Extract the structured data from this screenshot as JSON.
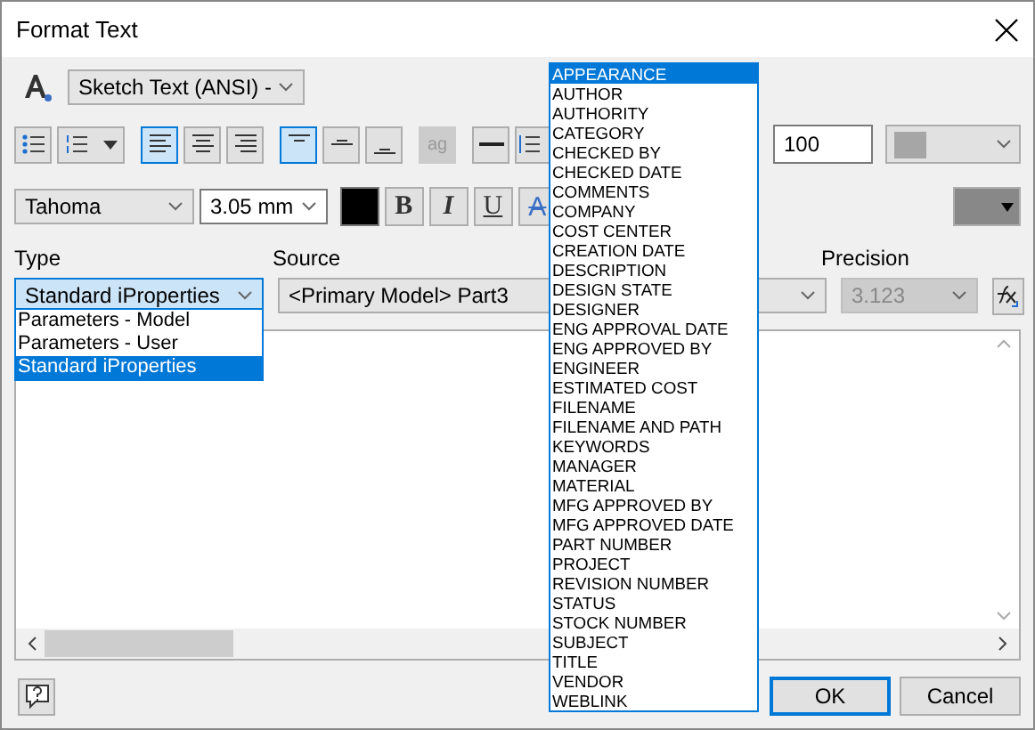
{
  "window": {
    "title": "Format Text"
  },
  "text_style": {
    "value": "Sketch Text (ANSI) -"
  },
  "toolbar": [
    {
      "kind": "bullets",
      "selected": false
    },
    {
      "kind": "numbering",
      "selected": false
    },
    {
      "kind": "align-left",
      "selected": true
    },
    {
      "kind": "align-center",
      "selected": false
    },
    {
      "kind": "align-right",
      "selected": false
    },
    {
      "kind": "valign-top",
      "selected": true
    },
    {
      "kind": "valign-middle",
      "selected": false
    },
    {
      "kind": "valign-bottom",
      "selected": false
    },
    {
      "kind": "stack",
      "disabled": true,
      "label": "ag"
    },
    {
      "kind": "line",
      "selected": false
    },
    {
      "kind": "line-spacing",
      "selected": false
    }
  ],
  "width_scale": {
    "value": "100"
  },
  "font": {
    "value": "Tahoma"
  },
  "size": {
    "value": "3.05 mm"
  },
  "format_buttons": [
    {
      "kind": "bold",
      "label": "B"
    },
    {
      "kind": "italic",
      "label": "I"
    },
    {
      "kind": "underline",
      "label": "U"
    },
    {
      "kind": "strike",
      "label": "A"
    }
  ],
  "type": {
    "label": "Type",
    "value": "Standard iProperties",
    "options": [
      {
        "label": "Parameters - Model",
        "selected": false
      },
      {
        "label": "Parameters - User",
        "selected": false
      },
      {
        "label": "Standard iProperties",
        "selected": true
      }
    ]
  },
  "source": {
    "label": "Source",
    "value": "<Primary Model> Part3",
    "options": [
      {
        "label": "APPEARANCE",
        "selected": true
      },
      {
        "label": "AUTHOR",
        "selected": false
      },
      {
        "label": "AUTHORITY",
        "selected": false
      },
      {
        "label": "CATEGORY",
        "selected": false
      },
      {
        "label": "CHECKED BY",
        "selected": false
      },
      {
        "label": "CHECKED DATE",
        "selected": false
      },
      {
        "label": "COMMENTS",
        "selected": false
      },
      {
        "label": "COMPANY",
        "selected": false
      },
      {
        "label": "COST CENTER",
        "selected": false
      },
      {
        "label": "CREATION DATE",
        "selected": false
      },
      {
        "label": "DESCRIPTION",
        "selected": false
      },
      {
        "label": "DESIGN STATE",
        "selected": false
      },
      {
        "label": "DESIGNER",
        "selected": false
      },
      {
        "label": "ENG APPROVAL DATE",
        "selected": false
      },
      {
        "label": "ENG APPROVED BY",
        "selected": false
      },
      {
        "label": "ENGINEER",
        "selected": false
      },
      {
        "label": "ESTIMATED COST",
        "selected": false
      },
      {
        "label": "FILENAME",
        "selected": false
      },
      {
        "label": "FILENAME AND PATH",
        "selected": false
      },
      {
        "label": "KEYWORDS",
        "selected": false
      },
      {
        "label": "MANAGER",
        "selected": false
      },
      {
        "label": "MATERIAL",
        "selected": false
      },
      {
        "label": "MFG APPROVED BY",
        "selected": false
      },
      {
        "label": "MFG APPROVED DATE",
        "selected": false
      },
      {
        "label": "PART NUMBER",
        "selected": false
      },
      {
        "label": "PROJECT",
        "selected": false
      },
      {
        "label": "REVISION NUMBER",
        "selected": false
      },
      {
        "label": "STATUS",
        "selected": false
      },
      {
        "label": "STOCK NUMBER",
        "selected": false
      },
      {
        "label": "SUBJECT",
        "selected": false
      },
      {
        "label": "TITLE",
        "selected": false
      },
      {
        "label": "VENDOR",
        "selected": false
      },
      {
        "label": "WEBLINK",
        "selected": false
      }
    ]
  },
  "precision": {
    "label": "Precision",
    "value": "3.123",
    "disabled": true
  },
  "buttons": [
    {
      "label": "OK",
      "default": true
    },
    {
      "label": "Cancel",
      "default": false
    }
  ]
}
